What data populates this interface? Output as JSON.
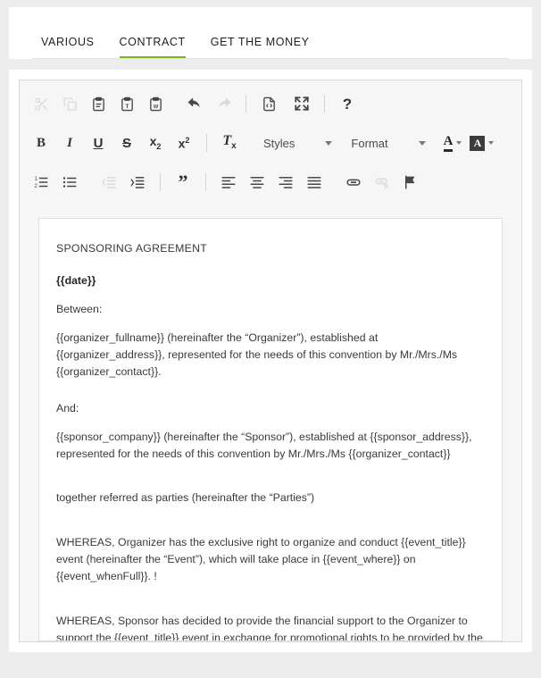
{
  "tabs": {
    "items": [
      {
        "label": "VARIOUS",
        "active": false
      },
      {
        "label": "CONTRACT",
        "active": true
      },
      {
        "label": "GET THE MONEY",
        "active": false
      }
    ],
    "active_color": "#7cb518"
  },
  "editor": {
    "toolbar": {
      "row1": [
        {
          "name": "cut",
          "title": "Cut",
          "disabled": true
        },
        {
          "name": "copy",
          "title": "Copy",
          "disabled": true
        },
        {
          "name": "paste",
          "title": "Paste",
          "disabled": false
        },
        {
          "name": "paste-text",
          "title": "Paste as plain text",
          "disabled": false
        },
        {
          "name": "paste-word",
          "title": "Paste from Word",
          "disabled": false
        },
        {
          "name": "undo",
          "title": "Undo",
          "disabled": false
        },
        {
          "name": "redo",
          "title": "Redo",
          "disabled": true
        },
        {
          "name": "source",
          "title": "Source",
          "disabled": false
        },
        {
          "name": "maximize",
          "title": "Maximize",
          "disabled": false
        },
        {
          "name": "help",
          "title": "About",
          "disabled": false
        }
      ],
      "row2": {
        "bold": "B",
        "italic": "I",
        "underline": "U",
        "strike": "S",
        "subscript": "x",
        "subscript_mark": "2",
        "superscript": "x",
        "superscript_mark": "2",
        "remove_format": "T",
        "remove_format_mark": "x",
        "styles_label": "Styles",
        "format_label": "Format",
        "text_color_label": "A",
        "bg_color_label": "A"
      },
      "row3": [
        {
          "name": "numbered-list",
          "title": "Insert/Remove Numbered List",
          "disabled": false
        },
        {
          "name": "bulleted-list",
          "title": "Insert/Remove Bulleted List",
          "disabled": false
        },
        {
          "name": "outdent",
          "title": "Decrease Indent",
          "disabled": true
        },
        {
          "name": "indent",
          "title": "Increase Indent",
          "disabled": false
        },
        {
          "name": "blockquote",
          "title": "Block Quote",
          "disabled": false
        },
        {
          "name": "align-left",
          "title": "Align Left",
          "disabled": false
        },
        {
          "name": "align-center",
          "title": "Center",
          "disabled": false
        },
        {
          "name": "align-right",
          "title": "Align Right",
          "disabled": false
        },
        {
          "name": "justify",
          "title": "Justify",
          "disabled": false
        },
        {
          "name": "link",
          "title": "Link",
          "disabled": false
        },
        {
          "name": "unlink",
          "title": "Unlink",
          "disabled": true
        },
        {
          "name": "anchor",
          "title": "Anchor",
          "disabled": false
        }
      ]
    },
    "document": {
      "title": "SPONSORING AGREEMENT",
      "date_token": "{{date}}",
      "between_label": "Between:",
      "organizer_para": "{{organizer_fullname}} (hereinafter the “Organizer”), established at {{organizer_address}}, represented for the needs of this convention by Mr./Mrs./Ms {{organizer_contact}}.",
      "and_label": "And:",
      "sponsor_para": "{{sponsor_company}} (hereinafter the “Sponsor”), established at {{sponsor_address}}, represented for the needs of this convention by Mr./Mrs./Ms {{organizer_contact}}",
      "parties_para": "together referred as parties (hereinafter the “Parties”)",
      "whereas_one": "WHEREAS, Organizer has the exclusive right to organize and conduct {{event_title}} event (hereinafter the “Event”), which will take place in {{event_where}} on {{event_whenFull}}. !",
      "whereas_two": "WHEREAS, Sponsor has decided to provide the financial support to the Organizer to support the {{event_title}} event in exchange for promotional rights to be provided by the Organizer."
    }
  }
}
